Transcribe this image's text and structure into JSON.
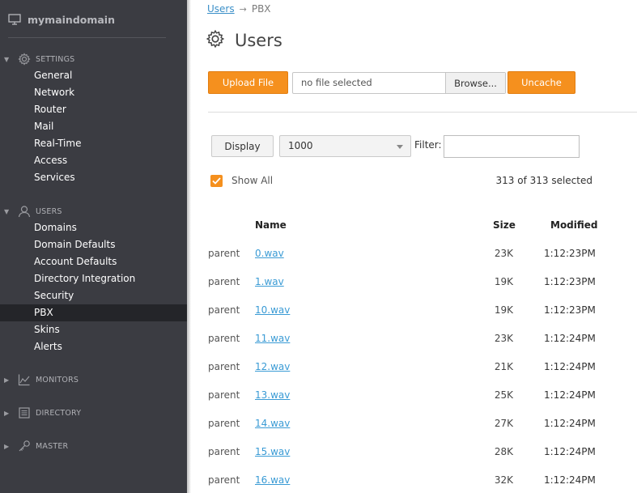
{
  "sidebar": {
    "domain": "mymaindomain",
    "sections": {
      "settings": "SETTINGS",
      "users": "USERS",
      "monitors": "MONITORS",
      "directory": "DIRECTORY",
      "master": "MASTER"
    },
    "settings_items": [
      "General",
      "Network",
      "Router",
      "Mail",
      "Real-Time",
      "Access",
      "Services"
    ],
    "users_items": [
      "Domains",
      "Domain Defaults",
      "Account Defaults",
      "Directory Integration",
      "Security",
      "PBX",
      "Skins",
      "Alerts"
    ],
    "active_item": "PBX"
  },
  "breadcrumb": {
    "link": "Users",
    "separator": "→",
    "current": "PBX"
  },
  "page_title": "Users",
  "upload": {
    "upload_label": "Upload File",
    "file_text": "no file selected",
    "browse_label": "Browse...",
    "uncache_label": "Uncache"
  },
  "filters": {
    "display_label": "Display",
    "display_value": "1000",
    "filter_label": "Filter:",
    "filter_value": ""
  },
  "show_all": {
    "label": "Show All",
    "checked": true
  },
  "selected_count": "313 of 313 selected",
  "table": {
    "headers": {
      "name": "Name",
      "size": "Size",
      "modified": "Modified"
    },
    "rows": [
      {
        "parent": "parent",
        "name": "0.wav",
        "size": "23K",
        "modified": "1:12:23PM"
      },
      {
        "parent": "parent",
        "name": "1.wav",
        "size": "19K",
        "modified": "1:12:23PM"
      },
      {
        "parent": "parent",
        "name": "10.wav",
        "size": "19K",
        "modified": "1:12:23PM"
      },
      {
        "parent": "parent",
        "name": "11.wav",
        "size": "23K",
        "modified": "1:12:24PM"
      },
      {
        "parent": "parent",
        "name": "12.wav",
        "size": "21K",
        "modified": "1:12:24PM"
      },
      {
        "parent": "parent",
        "name": "13.wav",
        "size": "25K",
        "modified": "1:12:24PM"
      },
      {
        "parent": "parent",
        "name": "14.wav",
        "size": "27K",
        "modified": "1:12:24PM"
      },
      {
        "parent": "parent",
        "name": "15.wav",
        "size": "28K",
        "modified": "1:12:24PM"
      },
      {
        "parent": "parent",
        "name": "16.wav",
        "size": "32K",
        "modified": "1:12:24PM"
      }
    ]
  },
  "colors": {
    "accent": "#f5901e",
    "sidebar_bg": "#3b3c42",
    "link": "#3a9bd5"
  }
}
